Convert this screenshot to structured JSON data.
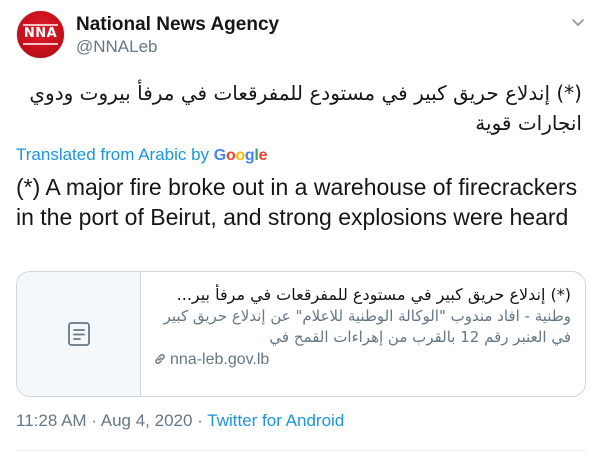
{
  "author": {
    "display_name": "National News Agency",
    "handle": "@NNALeb",
    "avatar_text": "NNA"
  },
  "tweet": {
    "text_arabic": "(*) إندلاع حريق كبير في مستودع للمفرقعات في مرفأ بيروت ودوي انجارات قوية",
    "translated_label": "Translated from Arabic by",
    "translator": "Google",
    "text_english": "(*) A major fire broke out in a warehouse of firecrackers in the port of Beirut, and strong explosions were heard"
  },
  "link_card": {
    "title": "(*) إندلاع حريق كبير في مستودع للمفرقعات في مرفأ بير...",
    "description": "وطنية - افاد مندوب \"الوكالة الوطنية للاعلام\" عن إندلاع حريق كبير في العنبر رقم 12 بالقرب من إهراءات القمح في",
    "domain": "nna-leb.gov.lb",
    "thumb_icon": "document-icon"
  },
  "meta": {
    "time": "11:28 AM",
    "separator1": " · ",
    "date": "Aug 4, 2020",
    "separator2": " · ",
    "source": "Twitter for Android"
  },
  "colors": {
    "link_blue": "#1b95e0",
    "secondary_text": "#657786",
    "avatar_red": "#c4101c"
  }
}
